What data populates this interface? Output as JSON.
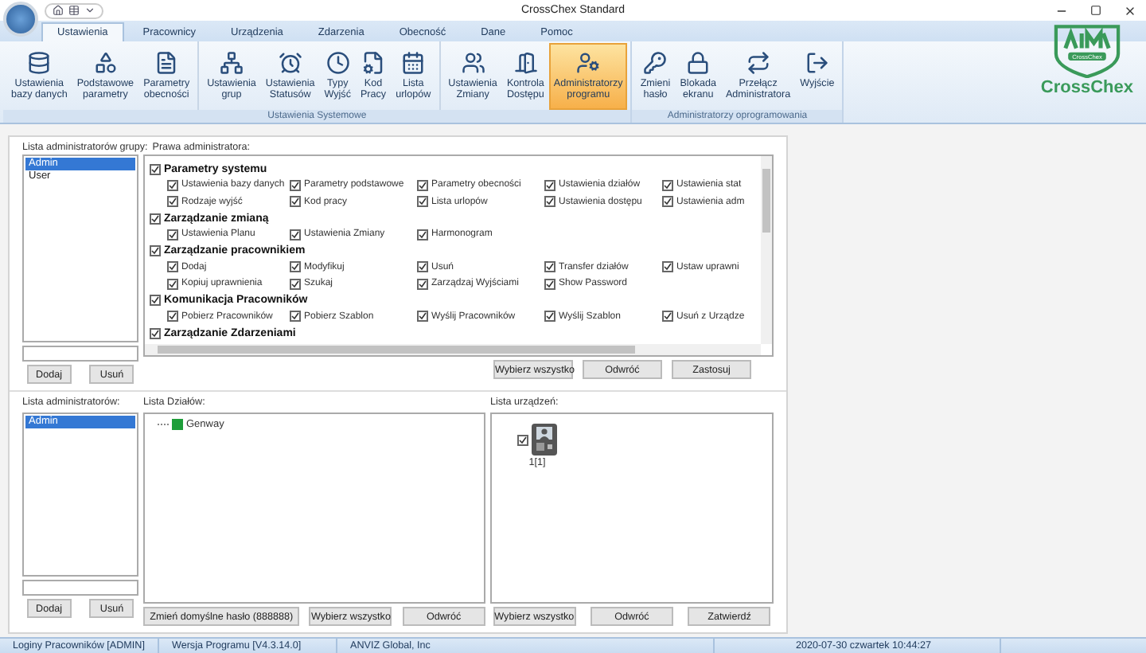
{
  "window": {
    "title": "CrossChex Standard"
  },
  "ribbon_tabs": [
    {
      "label": "Ustawienia",
      "selected": true
    },
    {
      "label": "Pracownicy",
      "selected": false
    },
    {
      "label": "Urządzenia",
      "selected": false
    },
    {
      "label": "Zdarzenia",
      "selected": false
    },
    {
      "label": "Obecność",
      "selected": false
    },
    {
      "label": "Dane",
      "selected": false
    },
    {
      "label": "Pomoc",
      "selected": false
    }
  ],
  "ribbon_groups": [
    {
      "label": "Ustawienia Systemowe",
      "sections": [
        [
          {
            "lines": [
              "Ustawienia",
              "bazy danych"
            ],
            "selected": false
          },
          {
            "lines": [
              "Podstawowe",
              "parametry"
            ],
            "selected": false
          },
          {
            "lines": [
              "Parametry",
              "obecności"
            ],
            "selected": false
          }
        ],
        [
          {
            "lines": [
              "Ustawienia",
              "grup"
            ],
            "selected": false
          },
          {
            "lines": [
              "Ustawienia",
              "Statusów"
            ],
            "selected": false
          },
          {
            "lines": [
              "Typy",
              "Wyjść"
            ],
            "selected": false
          },
          {
            "lines": [
              "Kod",
              "Pracy"
            ],
            "selected": false
          },
          {
            "lines": [
              "Lista",
              "urlopów"
            ],
            "selected": false
          }
        ],
        [
          {
            "lines": [
              "Ustawienia",
              "Zmiany"
            ],
            "selected": false
          },
          {
            "lines": [
              "Kontrola",
              "Dostępu"
            ],
            "selected": false
          },
          {
            "lines": [
              "Administratorzy",
              "programu"
            ],
            "selected": true
          }
        ]
      ]
    },
    {
      "label": "Administratorzy oprogramowania",
      "sections": [
        [
          {
            "lines": [
              "Zmieni",
              "hasło"
            ],
            "selected": false
          },
          {
            "lines": [
              "Blokada",
              "ekranu"
            ],
            "selected": false
          },
          {
            "lines": [
              "Przełącz",
              "Administratora"
            ],
            "selected": false
          },
          {
            "lines": [
              "Wyjście"
            ],
            "selected": false
          }
        ]
      ]
    }
  ],
  "logo": {
    "badge": "CrossChex",
    "name": "CrossChex"
  },
  "group_admins": {
    "label": "Lista administratorów grupy:",
    "items": [
      {
        "name": "Admin",
        "selected": true
      },
      {
        "name": "User",
        "selected": false
      }
    ],
    "buttons": [
      "Dodaj",
      "Usuń"
    ]
  },
  "rights": {
    "label": "Prawa administratora:",
    "groups": [
      {
        "name": "Parametry systemu",
        "checked": true,
        "items": [
          {
            "label": "Ustawienia bazy  danych",
            "checked": true
          },
          {
            "label": "Parametry podstawowe",
            "checked": true
          },
          {
            "label": "Parametry obecności",
            "checked": true
          },
          {
            "label": "Ustawienia działów",
            "checked": true
          },
          {
            "label": "Ustawienia stat",
            "checked": true
          },
          {
            "label": "Rodzaje wyjść",
            "checked": true
          },
          {
            "label": "Kod pracy",
            "checked": true
          },
          {
            "label": "Lista urlopów",
            "checked": true
          },
          {
            "label": "Ustawienia dostępu",
            "checked": true
          },
          {
            "label": "Ustawienia adm",
            "checked": true
          }
        ]
      },
      {
        "name": "Zarządzanie zmianą",
        "checked": true,
        "items": [
          {
            "label": "Ustawienia Planu",
            "checked": true
          },
          {
            "label": "Ustawienia Zmiany",
            "checked": true
          },
          {
            "label": "Harmonogram",
            "checked": true
          }
        ]
      },
      {
        "name": "Zarządzanie pracownikiem",
        "checked": true,
        "items": [
          {
            "label": "Dodaj",
            "checked": true
          },
          {
            "label": "Modyfikuj",
            "checked": true
          },
          {
            "label": "Usuń",
            "checked": true
          },
          {
            "label": "Transfer działów",
            "checked": true
          },
          {
            "label": "Ustaw uprawni",
            "checked": true
          },
          {
            "label": "Kopiuj uprawnienia",
            "checked": true
          },
          {
            "label": "Szukaj",
            "checked": true
          },
          {
            "label": "Zarządzaj Wyjściami",
            "checked": true
          },
          {
            "label": "Show Password",
            "checked": true
          }
        ]
      },
      {
        "name": "Komunikacja Pracowników",
        "checked": true,
        "items": [
          {
            "label": "Pobierz Pracowników",
            "checked": true
          },
          {
            "label": "Pobierz Szablon",
            "checked": true
          },
          {
            "label": "Wyślij Pracowników",
            "checked": true
          },
          {
            "label": "Wyślij Szablon",
            "checked": true
          },
          {
            "label": "Usuń z Urządze",
            "checked": true
          }
        ]
      },
      {
        "name": "Zarządzanie Zdarzeniami",
        "checked": true
      }
    ],
    "buttons": [
      "Wybierz wszystko",
      "Odwróć",
      "Zastosuj"
    ]
  },
  "admins": {
    "label": "Lista administratorów:",
    "items": [
      {
        "name": "Admin",
        "selected": true
      }
    ],
    "buttons": [
      "Dodaj",
      "Usuń"
    ]
  },
  "departments": {
    "label": "Lista Działów:",
    "tree": [
      {
        "name": "Genway"
      }
    ],
    "buttons": [
      "Zmień domyślne hasło (888888)",
      "Wybierz wszystko",
      "Odwróć"
    ]
  },
  "devices": {
    "label": "Lista urządzeń:",
    "items": [
      {
        "name": "1[1]",
        "checked": true
      }
    ],
    "buttons": [
      "Wybierz wszystko",
      "Odwróć",
      "Zatwierdź"
    ]
  },
  "status_bar": [
    "Loginy Pracowników [ADMIN]",
    "Wersja Programu [V4.3.14.0]",
    "ANVIZ Global, Inc",
    "2020-07-30 czwartek 10:44:27"
  ]
}
